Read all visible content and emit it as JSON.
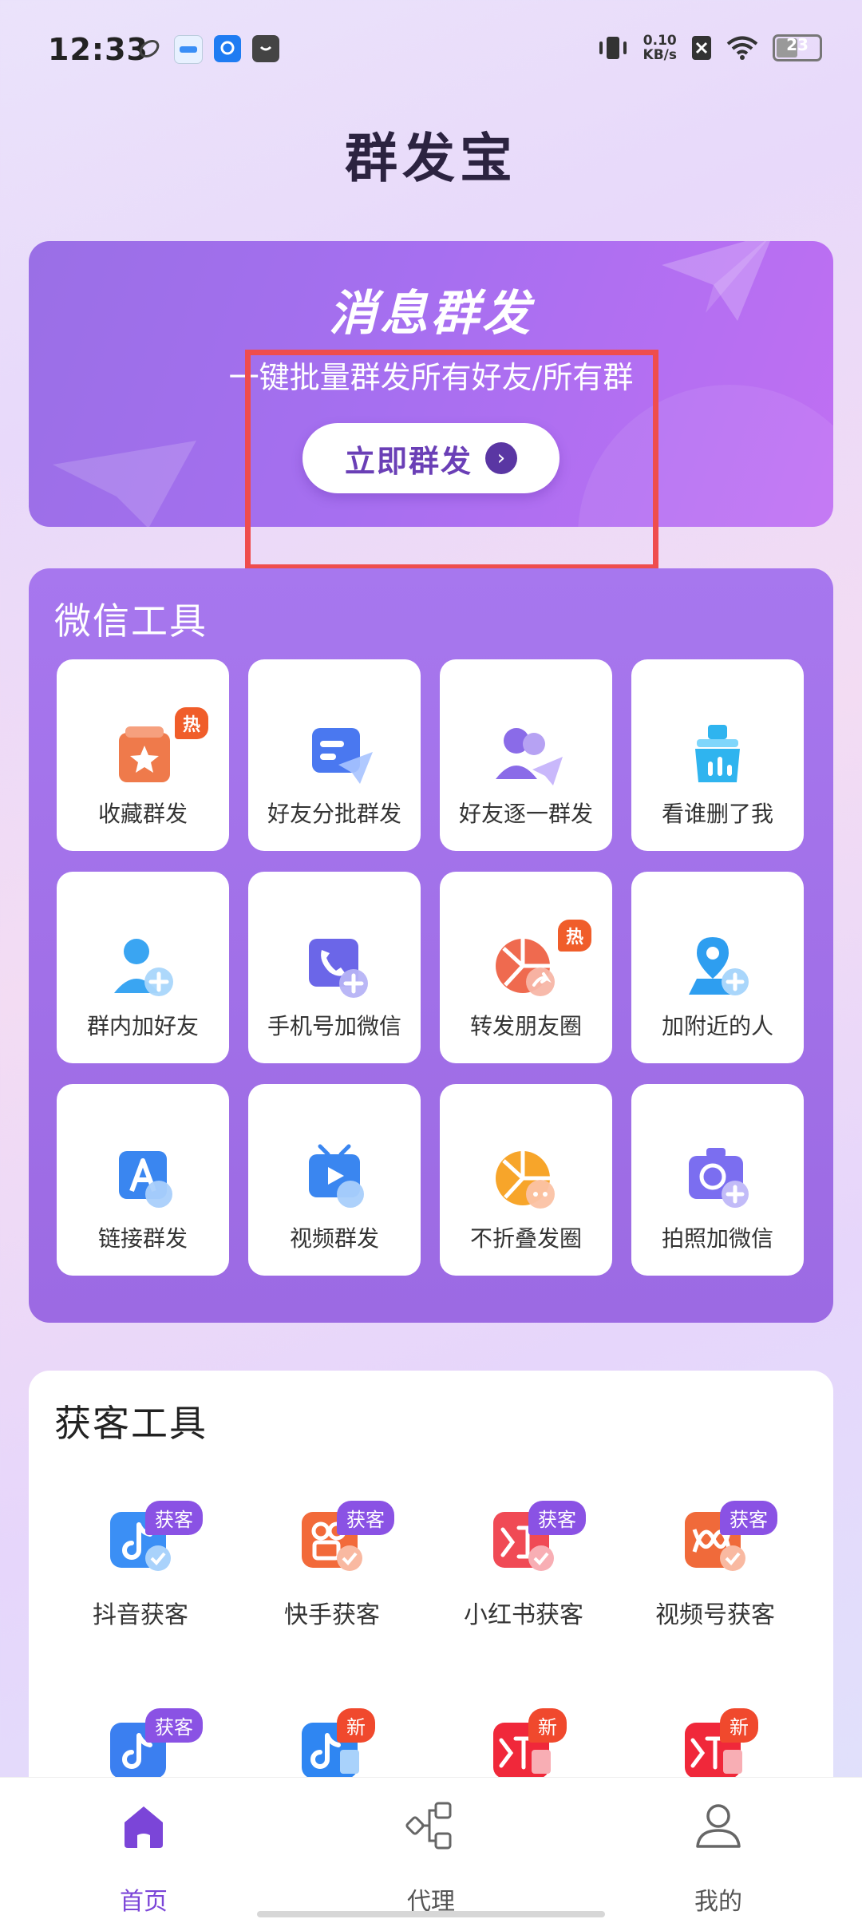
{
  "status_bar": {
    "time": "12:33",
    "net_speed_value": "0.10",
    "net_speed_unit": "KB/s",
    "battery": "23"
  },
  "app_title": "群发宝",
  "banner": {
    "title": "消息群发",
    "subtitle": "一键批量群发所有好友/所有群",
    "button_label": "立即群发"
  },
  "wechat_tools": {
    "title": "微信工具",
    "hot_tag": "热",
    "items": [
      {
        "label": "收藏群发",
        "icon": "favorites-icon"
      },
      {
        "label": "好友分批群发",
        "icon": "batch-send-icon"
      },
      {
        "label": "好友逐一群发",
        "icon": "friends-send-icon"
      },
      {
        "label": "看谁删了我",
        "icon": "cleaner-icon"
      },
      {
        "label": "群内加好友",
        "icon": "add-person-icon"
      },
      {
        "label": "手机号加微信",
        "icon": "phone-add-icon"
      },
      {
        "label": "转发朋友圈",
        "icon": "moments-forward-icon"
      },
      {
        "label": "加附近的人",
        "icon": "location-add-icon"
      },
      {
        "label": "链接群发",
        "icon": "link-send-icon"
      },
      {
        "label": "视频群发",
        "icon": "video-send-icon"
      },
      {
        "label": "不折叠发圈",
        "icon": "moments-icon"
      },
      {
        "label": "拍照加微信",
        "icon": "camera-add-icon"
      }
    ]
  },
  "acquire_tools": {
    "title": "获客工具",
    "badge_acquire": "获客",
    "badge_new": "新",
    "items": [
      {
        "label": "抖音获客",
        "icon": "douyin-icon"
      },
      {
        "label": "快手获客",
        "icon": "kuaishou-icon"
      },
      {
        "label": "小红书获客",
        "icon": "xiaohongshu-icon"
      },
      {
        "label": "视频号获客",
        "icon": "channels-icon"
      }
    ]
  },
  "bottom_nav": {
    "items": [
      {
        "label": "首页",
        "icon": "home-icon",
        "active": true
      },
      {
        "label": "代理",
        "icon": "network-icon",
        "active": false
      },
      {
        "label": "我的",
        "icon": "profile-icon",
        "active": false
      }
    ]
  },
  "colors": {
    "accent": "#7b45d8",
    "hot": "#f05d2a",
    "highlight": "#ef4d4d"
  }
}
